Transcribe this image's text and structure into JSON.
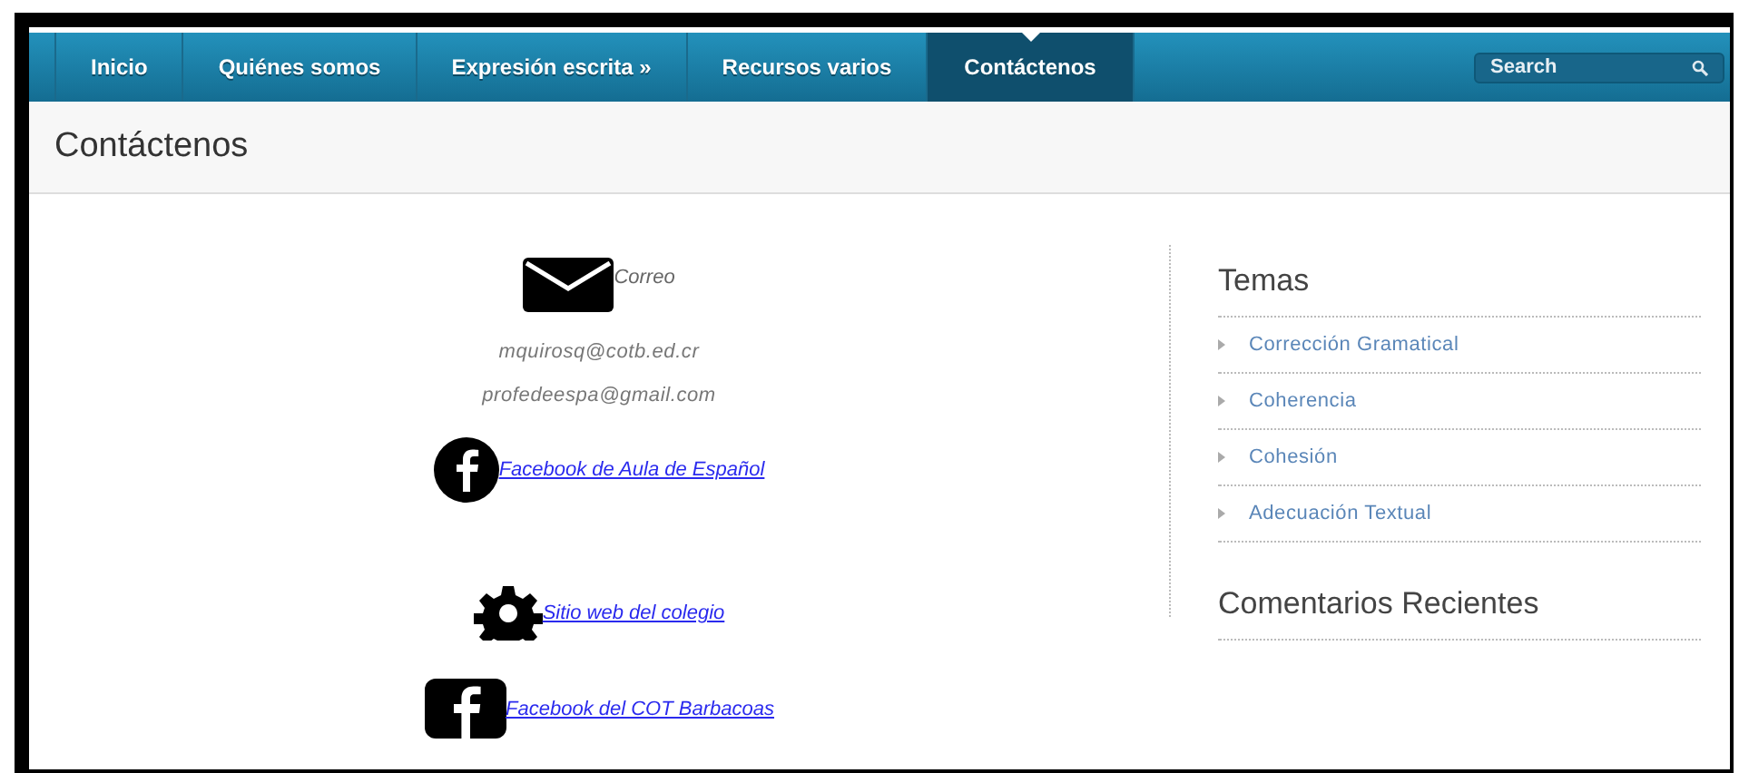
{
  "nav": {
    "items": [
      {
        "label": "Inicio",
        "selected": false
      },
      {
        "label": "Quiénes somos",
        "selected": false
      },
      {
        "label": "Expresión escrita »",
        "selected": false
      },
      {
        "label": "Recursos varios",
        "selected": false
      },
      {
        "label": "Contáctenos",
        "selected": true
      }
    ],
    "search": {
      "placeholder": "Search"
    }
  },
  "page_title": "Contáctenos",
  "contacts": [
    {
      "kind": "label",
      "text": "Correo"
    },
    {
      "kind": "text",
      "text": "mquirosq@cotb.ed.cr"
    },
    {
      "kind": "text",
      "text": "profedeespa@gmail.com"
    },
    {
      "kind": "link",
      "text": "Facebook de Aula de Español"
    },
    {
      "kind": "link",
      "text": "Sitio web del colegio"
    },
    {
      "kind": "link",
      "text": "Facebook del COT Barbacoas"
    }
  ],
  "sidebar": [
    {
      "heading": "Temas",
      "items": [
        "Corrección Gramatical",
        "Coherencia",
        "Cohesión",
        "Adecuación Textual"
      ]
    },
    {
      "heading": "Comentarios Recientes"
    }
  ]
}
